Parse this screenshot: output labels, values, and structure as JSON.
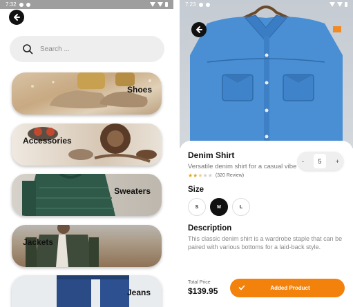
{
  "colors": {
    "accent": "#f2820c",
    "dark": "#111111",
    "search_bg": "#eeeeee",
    "star": "#e0a31c"
  },
  "left_screen": {
    "status": {
      "time": "7:32"
    },
    "back_icon": "back-arrow-icon",
    "search": {
      "placeholder": "Search ...",
      "icon": "search-icon"
    },
    "categories": [
      {
        "label": "Shoes"
      },
      {
        "label": "Accessories"
      },
      {
        "label": "Sweaters"
      },
      {
        "label": "Jackets"
      },
      {
        "label": "Jeans"
      }
    ]
  },
  "right_screen": {
    "status": {
      "time": "7:23"
    },
    "back_icon": "back-arrow-icon",
    "product": {
      "name": "Denim Shirt",
      "subtitle": "Versatile denim shirt for a casual vibe",
      "rating": 2.5,
      "reviews": "(320 Review)",
      "quantity": "5",
      "minus": "-",
      "plus": "+"
    },
    "size_heading": "Size",
    "sizes": [
      "S",
      "M",
      "L"
    ],
    "selected_size": "M",
    "description_heading": "Description",
    "description": "This classic denim shirt is a wardrobe staple that can be paired with various bottoms for a laid-back style.",
    "total_label": "Total Price",
    "total_value": "$139.95",
    "add_button": "Added Product"
  }
}
